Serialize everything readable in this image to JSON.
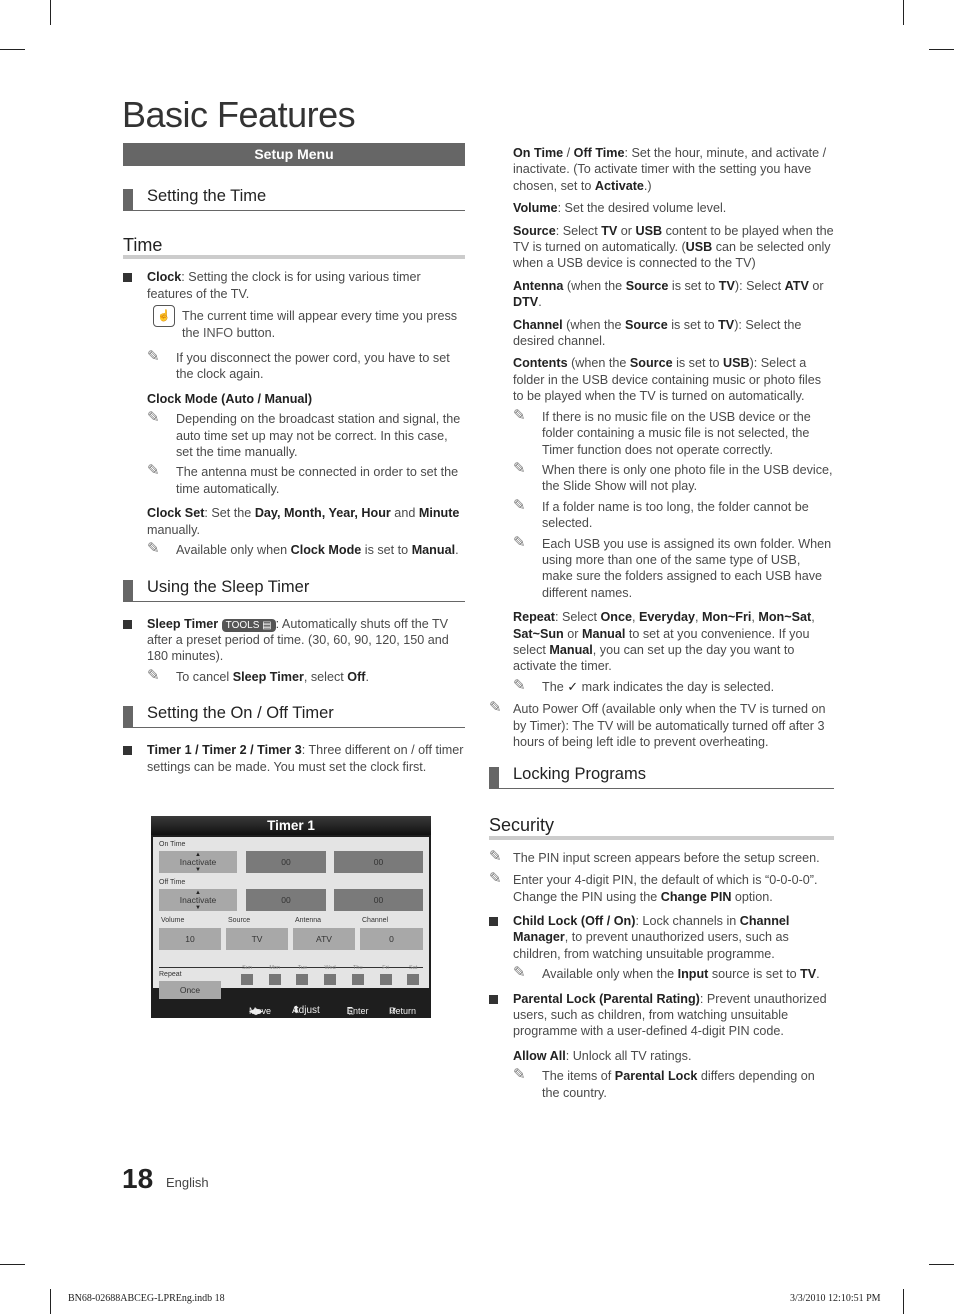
{
  "page": {
    "title": "Basic Features",
    "page_number": "18",
    "language": "English",
    "slug_left": "BN68-02688ABCEG-LPREng.indb   18",
    "slug_right": "3/3/2010   12:10:51 PM"
  },
  "left": {
    "setup_bar": "Setup Menu",
    "setting_time_heading": "Setting the Time",
    "time_heading": "Time",
    "clock": {
      "label": "Clock",
      "text": ": Setting the clock is for using various timer features of the TV.",
      "info_note_pre": "The current time will appear every time you press the ",
      "info_note_key": "INFO",
      "info_note_post": " button.",
      "note1": "If you disconnect the power cord, you have to set the clock again."
    },
    "clock_mode": {
      "label": "Clock Mode (Auto / Manual)",
      "note1": "Depending on the broadcast station and signal, the auto time set up may not be correct. In this case, set the time manually.",
      "note2": "The antenna must be connected in order to set the time automatically."
    },
    "clock_set": {
      "label": "Clock Set",
      "text_pre": ": Set the ",
      "fields": "Day, Month, Year, Hour",
      "and": " and ",
      "minute": "Minute",
      "text_post": " manually.",
      "note_pre": "Available only when ",
      "note_b1": "Clock Mode",
      "note_mid": " is set to ",
      "note_b2": "Manual",
      "note_end": "."
    },
    "sleep_heading": "Using the Sleep Timer",
    "sleep": {
      "label": "Sleep Timer",
      "tools_badge": "TOOLS",
      "text": ": Automatically shuts off the TV after a preset period of time. (30, 60, 90, 120, 150 and 180 minutes).",
      "note_pre": "To cancel ",
      "note_b1": "Sleep Timer",
      "note_mid": ", select ",
      "note_b2": "Off",
      "note_end": "."
    },
    "onoff_heading": "Setting the On / Off Timer",
    "timers": {
      "label": "Timer 1 / Timer 2 / Timer 3",
      "text": ": Three different on / off timer settings can be made. You must set the clock first."
    }
  },
  "osd": {
    "title": "Timer 1",
    "on_time_label": "On Time",
    "off_time_label": "Off Time",
    "on_state": "Inactivate",
    "on_hour": "00",
    "on_minute": "00",
    "off_state": "Inactivate",
    "off_hour": "00",
    "off_minute": "00",
    "volume_label": "Volume",
    "volume": "10",
    "source_label": "Source",
    "source": "TV",
    "antenna_label": "Antenna",
    "antenna": "ATV",
    "channel_label": "Channel",
    "channel": "0",
    "repeat_label": "Repeat",
    "repeat": "Once",
    "days": [
      "Sun",
      "Mon",
      "Tue",
      "Wed",
      "Thu",
      "Fri",
      "Sat"
    ],
    "footer": {
      "move": "Move",
      "adjust": "Adjust",
      "enter": "Enter",
      "return": "Return"
    }
  },
  "right": {
    "on_off_time": {
      "b1": "On Time",
      "sep": " / ",
      "b2": "Off Time",
      "text": ": Set the hour, minute, and activate / inactivate. (To activate timer with the setting you have chosen, set to ",
      "b3": "Activate",
      "end": ".)"
    },
    "volume": {
      "label": "Volume",
      "text": ": Set the desired volume level."
    },
    "source": {
      "label": "Source",
      "t1": ": Select ",
      "tv": "TV",
      "t2": " or ",
      "usb": "USB",
      "t3": " content to be played when the TV is turned on automatically. (",
      "usb2": "USB",
      "t4": " can be selected only when a USB device is connected to the TV)"
    },
    "antenna": {
      "label": "Antenna",
      "t1": " (when the ",
      "source": "Source",
      "t2": " is set to ",
      "tv": "TV",
      "t3": "): Select ",
      "atv": "ATV",
      "t4": " or ",
      "dtv": "DTV",
      "end": "."
    },
    "channel": {
      "label": "Channel",
      "t1": " (when the ",
      "source": "Source",
      "t2": " is set to ",
      "tv": "TV",
      "t3": "): Select the desired channel."
    },
    "contents": {
      "label": "Contents",
      "t1": " (when the ",
      "source": "Source",
      "t2": " is set to ",
      "usb": "USB",
      "t3": "): Select a folder in the USB device containing music or photo files to be played when the TV is turned on automatically.",
      "notes": [
        "If there is no music file on the USB device or the folder containing a music file is not selected, the Timer function does not operate correctly.",
        "When there is only one photo file in the USB device, the Slide Show will not play.",
        "If a folder name is too long, the folder cannot be selected.",
        "Each USB you use is assigned its own folder. When using more than one of the same type of USB, make sure the folders assigned to each USB have different names."
      ]
    },
    "repeat": {
      "label": "Repeat",
      "t1": ": Select ",
      "o1": "Once",
      "c1": ", ",
      "o2": "Everyday",
      "c2": ", ",
      "o3": "Mon~Fri",
      "c3": ", ",
      "o4": "Mon~Sat",
      "c4": ", ",
      "o5": "Sat~Sun",
      "t2": " or ",
      "o6": "Manual",
      "t3": " to set at you convenience. If you select ",
      "o7": "Manual",
      "t4": ", you can set up the day you want to activate the timer.",
      "note_pre": "The ",
      "note_check": "✓",
      "note_post": " mark indicates the day is selected."
    },
    "auto_power_off": "Auto Power Off (available only when the TV is turned on by Timer): The TV will be automatically turned off after 3 hours of being left idle to prevent overheating.",
    "locking_heading": "Locking Programs",
    "security_heading": "Security",
    "security_note1": "The PIN input screen appears before the setup screen.",
    "security_note2_pre": "Enter your 4-digit PIN, the default of which is “0-0-0-0”. Change the PIN using the ",
    "security_note2_b": "Change PIN",
    "security_note2_post": " option.",
    "child_lock": {
      "label": "Child Lock (Off / On)",
      "t1": ": Lock channels in ",
      "b1": "Channel Manager",
      "t2": ", to prevent unauthorized users, such as children, from watching unsuitable programme.",
      "note_pre": "Available only when the ",
      "note_b1": "Input",
      "note_mid": " source is set to ",
      "note_b2": "TV",
      "note_end": "."
    },
    "parental_lock": {
      "label": "Parental Lock (Parental Rating)",
      "text": ": Prevent unauthorized users, such as children, from watching unsuitable programme with a user-defined 4-digit PIN code.",
      "allow_label": "Allow All",
      "allow_text": ": Unlock all TV ratings.",
      "note_pre": "The items of ",
      "note_b": "Parental Lock",
      "note_post": " differs depending on the country."
    }
  }
}
